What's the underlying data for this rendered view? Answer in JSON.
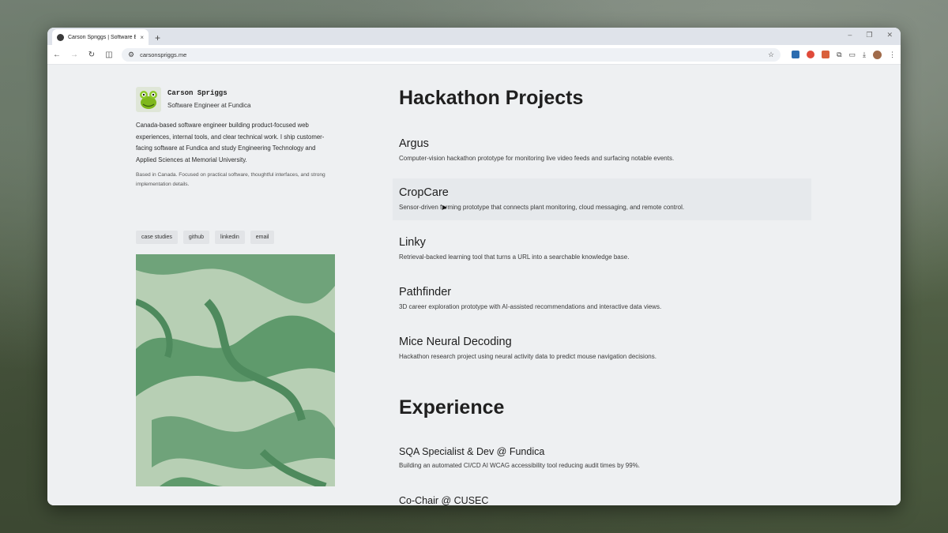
{
  "browser": {
    "tab_title": "Carson Spriggs | Software Engineer",
    "tab_close": "×",
    "new_tab": "+",
    "url": "carsonspriggs.me",
    "win_min": "–",
    "win_max": "❐",
    "win_close": "✕"
  },
  "profile": {
    "name": "Carson Spriggs",
    "role": "Software Engineer at Fundica",
    "bio": "Canada-based software engineer building product-focused web experiences, internal tools, and clear technical work. I ship customer-facing software at Fundica and study Engineering Technology and Applied Sciences at Memorial University.",
    "based": "Based in Canada. Focused on practical software, thoughtful interfaces, and strong implementation details."
  },
  "links": [
    "case studies",
    "github",
    "linkedin",
    "email"
  ],
  "hackathon": {
    "title": "Hackathon Projects",
    "projects": [
      {
        "name": "Argus",
        "desc": "Computer-vision hackathon prototype for monitoring live video feeds and surfacing notable events."
      },
      {
        "name": "CropCare",
        "desc": "Sensor-driven farming prototype that connects plant monitoring, cloud messaging, and remote control."
      },
      {
        "name": "Linky",
        "desc": "Retrieval-backed learning tool that turns a URL into a searchable knowledge base."
      },
      {
        "name": "Pathfinder",
        "desc": "3D career exploration prototype with AI-assisted recommendations and interactive data views."
      },
      {
        "name": "Mice Neural Decoding",
        "desc": "Hackathon research project using neural activity data to predict mouse navigation decisions."
      }
    ]
  },
  "experience": {
    "title": "Experience",
    "items": [
      {
        "name": "SQA Specialist & Dev @ Fundica",
        "desc": "Building an automated CI/CD AI WCAG accessibility tool reducing audit times by 99%."
      },
      {
        "name": "Co-Chair @ CUSEC",
        "desc": ""
      }
    ]
  },
  "colors": {
    "art_green": "#5f9a6c",
    "page_bg": "#eef0f2"
  }
}
